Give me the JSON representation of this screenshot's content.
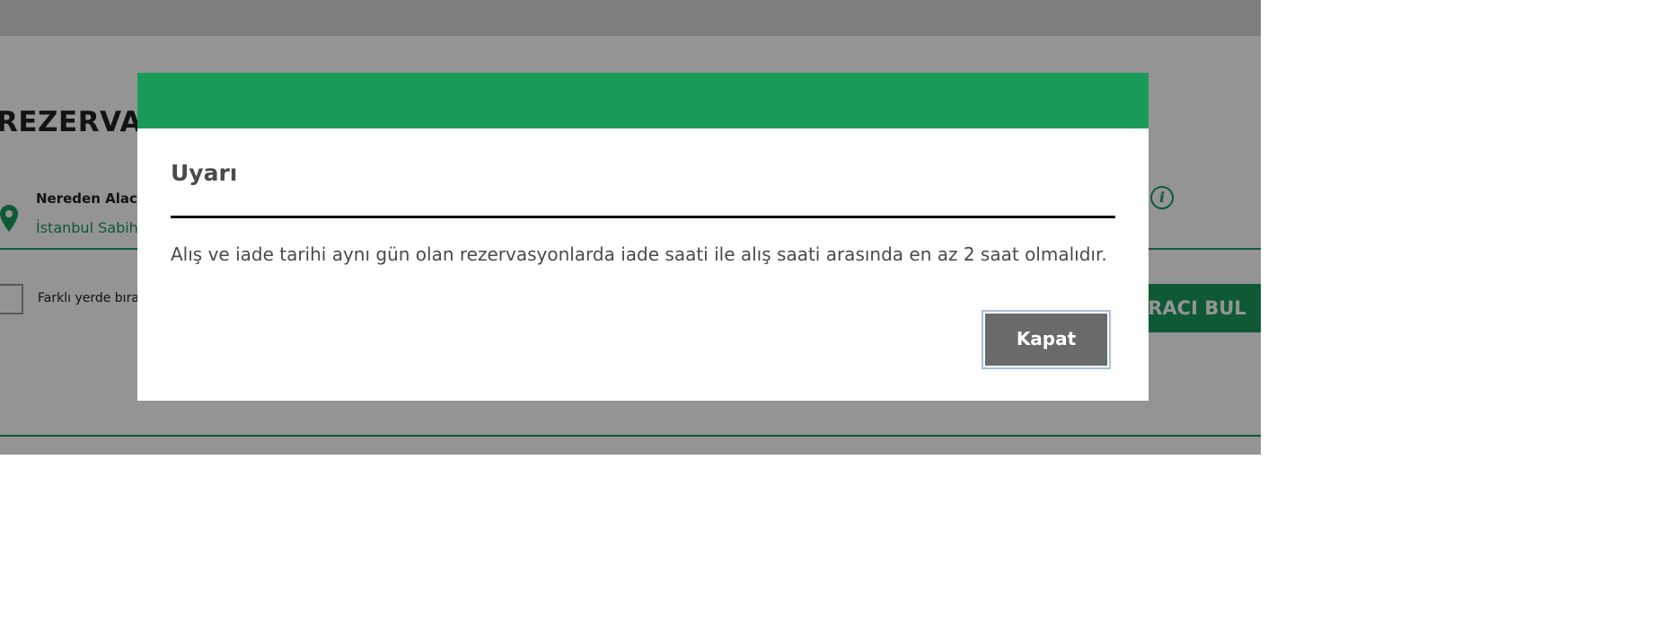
{
  "page": {
    "title": "REZERVAS",
    "from_label": "Nereden Alacak",
    "from_value": "İstanbul Sabiha",
    "different_return_label": "Farklı yerde bırak",
    "find_car_button": "ARACI BUL",
    "info_icon": "info-icon",
    "pin_icon": "map-pin-icon"
  },
  "modal": {
    "title": "Uyarı",
    "message": "Alış ve iade tarihi aynı gün olan rezervasyonlarda iade saati ile alış saati arasında en az 2 saat olmalıdır.",
    "close_label": "Kapat"
  },
  "colors": {
    "brand_green": "#1a9b5a",
    "overlay": "rgba(0,0,0,0.42)",
    "button_gray": "#6a6a6a"
  }
}
